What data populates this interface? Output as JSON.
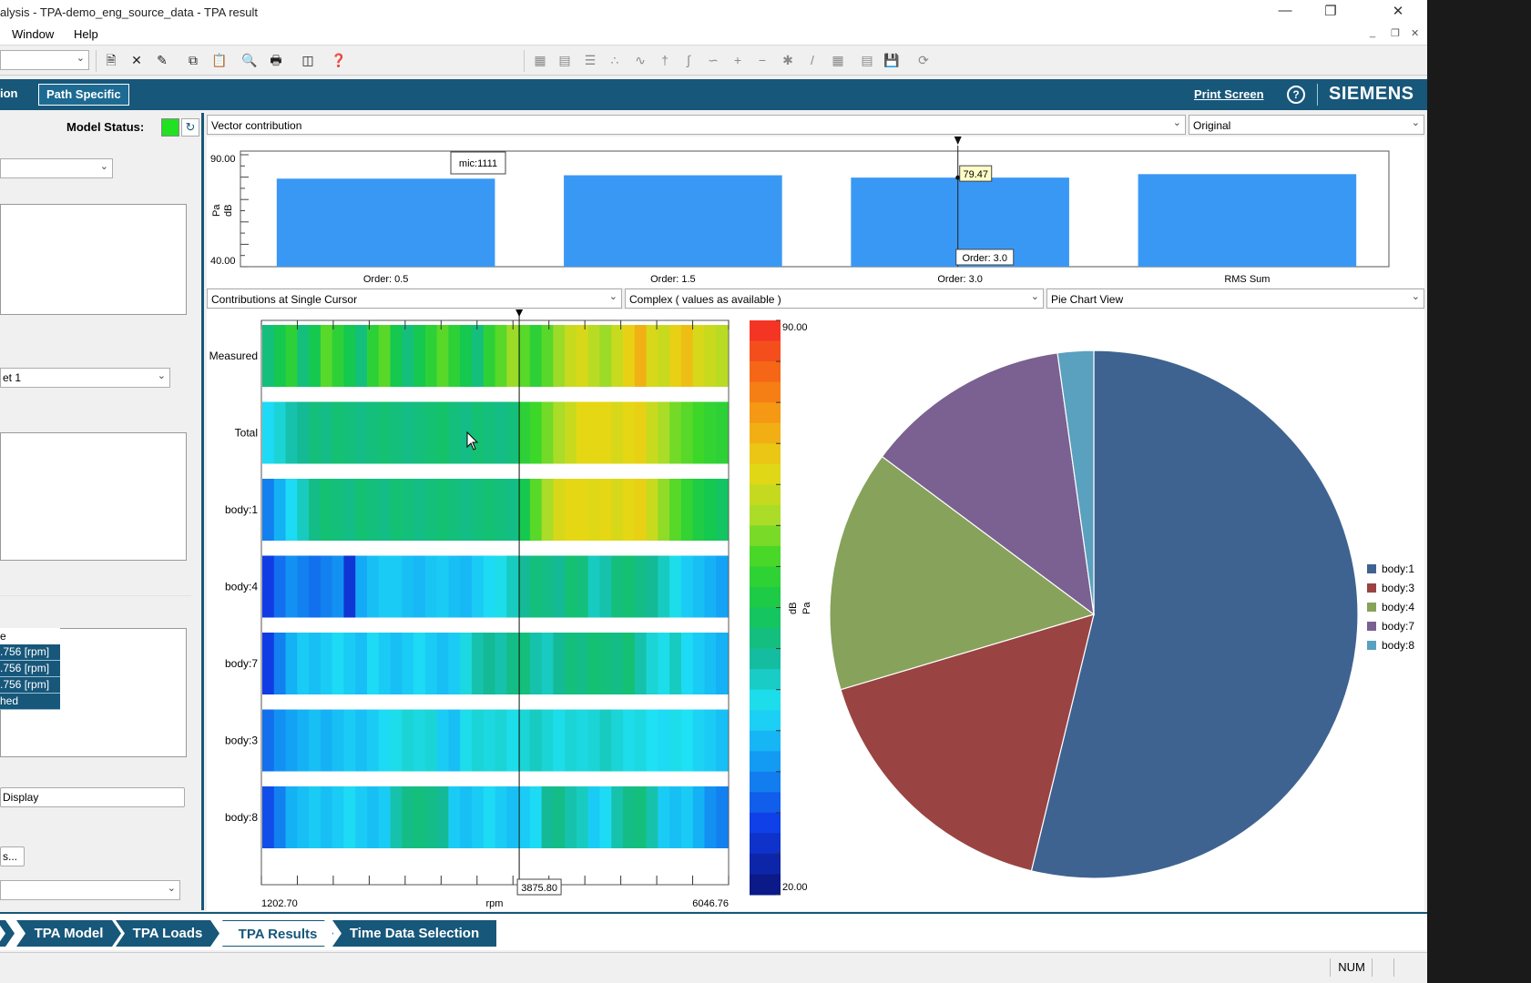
{
  "window": {
    "title": "alysis - TPA-demo_eng_source_data - TPA result",
    "minimize_glyph": "—",
    "restore_glyph": "❐",
    "close_glyph": "✕"
  },
  "menu": {
    "items": [
      "Window",
      "Help"
    ],
    "mdi_min": "_",
    "mdi_restore": "❐",
    "mdi_close": "✕"
  },
  "breadcrumb": {
    "items": [
      "ion",
      "Path Specific"
    ]
  },
  "header": {
    "print_screen": "Print Screen",
    "help": "?",
    "brand": "SIEMENS"
  },
  "left": {
    "model_status_label": "Model Status:",
    "refresh_glyph": "↻",
    "set_combo": "et 1",
    "rpm_header": "e",
    "rpm_rows": [
      ".756 [rpm]",
      ".756 [rpm]",
      ".756 [rpm]",
      "hed"
    ],
    "display_button": "Display",
    "more_button": "s..."
  },
  "top_controls": {
    "view_combo": "Vector contribution",
    "mode_combo": "Original"
  },
  "mid_controls": {
    "contrib_combo": "Contributions at Single Cursor",
    "complex_combo": "Complex ( values as available )",
    "pie_combo": "Pie Chart View"
  },
  "chart_data": [
    {
      "type": "bar",
      "categories": [
        "Order: 0.5",
        "Order: 1.5",
        "Order: 3.0",
        "RMS Sum"
      ],
      "values": [
        79.0,
        80.5,
        79.47,
        81.0
      ],
      "ylim": [
        40.0,
        90.0
      ],
      "ytick_labels": [
        "90.00",
        "40.00"
      ],
      "ylabel_unit": "dB",
      "ylabel_ref": "Pa",
      "channel_label": "mic:1111",
      "cursor_value_label": "79.47",
      "cursor_order_label": "Order: 3.0",
      "bar_color": "#3a98f5"
    },
    {
      "type": "heatmap",
      "rows": [
        "Measured",
        "Total",
        "body:1",
        "body:4",
        "body:7",
        "body:3",
        "body:8"
      ],
      "xlim": [
        1202.7,
        6046.76
      ],
      "x_start_label": "1202.70",
      "x_end_label": "6046.76",
      "xlabel": "rpm",
      "cursor_x": 3875.8,
      "cursor_label": "3875.80",
      "colorbar_range": [
        20.0,
        90.0
      ],
      "colorbar_max_label": "90.00",
      "colorbar_min_label": "20.00",
      "colorbar_unit": "dB",
      "colorbar_ref": "Pa",
      "row_levels": [
        [
          0.45,
          0.5,
          0.55,
          0.45,
          0.5,
          0.6,
          0.55,
          0.5,
          0.45,
          0.55,
          0.6,
          0.5,
          0.45,
          0.5,
          0.55,
          0.6,
          0.55,
          0.5,
          0.45,
          0.55,
          0.6,
          0.65,
          0.6,
          0.55,
          0.6,
          0.65,
          0.7,
          0.72,
          0.68,
          0.65,
          0.7,
          0.75,
          0.8,
          0.72,
          0.7,
          0.75,
          0.78,
          0.72,
          0.7,
          0.68
        ],
        [
          0.32,
          0.36,
          0.4,
          0.42,
          0.45,
          0.44,
          0.46,
          0.45,
          0.44,
          0.45,
          0.46,
          0.45,
          0.44,
          0.45,
          0.46,
          0.47,
          0.45,
          0.44,
          0.46,
          0.45,
          0.44,
          0.45,
          0.55,
          0.58,
          0.62,
          0.66,
          0.7,
          0.74,
          0.74,
          0.74,
          0.72,
          0.74,
          0.75,
          0.7,
          0.66,
          0.62,
          0.6,
          0.58,
          0.56,
          0.55
        ],
        [
          0.2,
          0.26,
          0.32,
          0.38,
          0.44,
          0.46,
          0.45,
          0.44,
          0.46,
          0.45,
          0.44,
          0.46,
          0.45,
          0.44,
          0.45,
          0.46,
          0.45,
          0.44,
          0.45,
          0.46,
          0.45,
          0.44,
          0.5,
          0.6,
          0.66,
          0.72,
          0.74,
          0.74,
          0.73,
          0.74,
          0.72,
          0.74,
          0.75,
          0.7,
          0.64,
          0.6,
          0.56,
          0.52,
          0.5,
          0.48
        ],
        [
          0.12,
          0.18,
          0.22,
          0.2,
          0.18,
          0.2,
          0.22,
          0.1,
          0.25,
          0.28,
          0.3,
          0.3,
          0.28,
          0.27,
          0.29,
          0.3,
          0.28,
          0.27,
          0.3,
          0.32,
          0.34,
          0.38,
          0.42,
          0.45,
          0.44,
          0.42,
          0.46,
          0.45,
          0.38,
          0.4,
          0.45,
          0.46,
          0.44,
          0.42,
          0.38,
          0.34,
          0.3,
          0.28,
          0.26,
          0.24
        ],
        [
          0.12,
          0.2,
          0.26,
          0.3,
          0.28,
          0.3,
          0.32,
          0.3,
          0.28,
          0.32,
          0.3,
          0.28,
          0.3,
          0.32,
          0.3,
          0.28,
          0.3,
          0.35,
          0.4,
          0.42,
          0.4,
          0.44,
          0.45,
          0.4,
          0.38,
          0.42,
          0.45,
          0.44,
          0.46,
          0.45,
          0.44,
          0.46,
          0.4,
          0.36,
          0.34,
          0.38,
          0.32,
          0.3,
          0.28,
          0.26
        ],
        [
          0.18,
          0.22,
          0.24,
          0.26,
          0.28,
          0.26,
          0.28,
          0.3,
          0.28,
          0.3,
          0.32,
          0.34,
          0.36,
          0.35,
          0.36,
          0.3,
          0.28,
          0.34,
          0.36,
          0.35,
          0.36,
          0.34,
          0.36,
          0.38,
          0.36,
          0.34,
          0.36,
          0.35,
          0.36,
          0.38,
          0.36,
          0.34,
          0.35,
          0.33,
          0.32,
          0.34,
          0.33,
          0.31,
          0.3,
          0.28
        ],
        [
          0.14,
          0.2,
          0.26,
          0.28,
          0.3,
          0.28,
          0.3,
          0.32,
          0.3,
          0.28,
          0.3,
          0.4,
          0.44,
          0.45,
          0.44,
          0.42,
          0.3,
          0.28,
          0.3,
          0.32,
          0.3,
          0.28,
          0.3,
          0.32,
          0.42,
          0.44,
          0.4,
          0.38,
          0.3,
          0.32,
          0.4,
          0.44,
          0.45,
          0.4,
          0.3,
          0.28,
          0.3,
          0.26,
          0.22,
          0.2
        ]
      ]
    },
    {
      "type": "pie",
      "labels": [
        "body:1",
        "body:3",
        "body:4",
        "body:7",
        "body:8"
      ],
      "values": [
        53.8,
        16.6,
        14.8,
        12.6,
        2.2
      ],
      "colors": [
        "#3f6391",
        "#9a4343",
        "#87a25a",
        "#7a6191",
        "#5aa0bf"
      ],
      "legend": "right"
    }
  ],
  "tabs": [
    {
      "label": "TPA Model",
      "selected": false
    },
    {
      "label": "TPA Loads",
      "selected": false
    },
    {
      "label": "TPA Results",
      "selected": true
    },
    {
      "label": "Time Data Selection",
      "selected": false
    }
  ],
  "status": {
    "num": "NUM"
  },
  "colors": {
    "accent": "#17577a",
    "status_ok": "#22e022"
  },
  "toolbar_icons": [
    "new-doc-icon",
    "delete-icon",
    "rename-icon",
    "copy-icon",
    "paste-icon",
    "print-preview-icon",
    "print-icon",
    "export-icon",
    "help-icon"
  ]
}
